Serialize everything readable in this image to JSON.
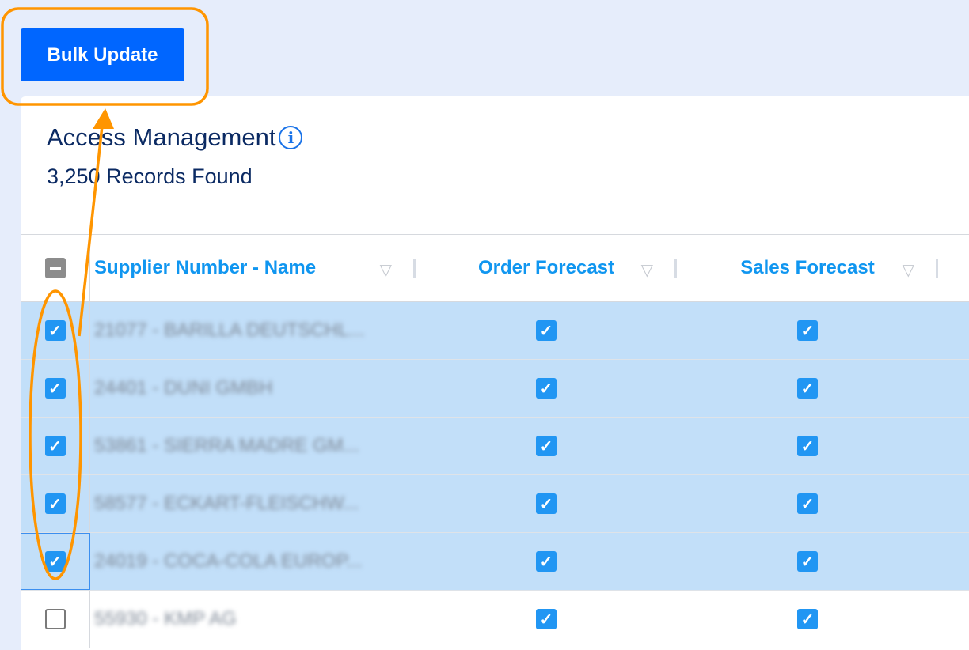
{
  "toolbar": {
    "bulk_update_label": "Bulk Update"
  },
  "header": {
    "title": "Access Management",
    "info_icon": "info-icon",
    "records_found": "3,250 Records Found"
  },
  "table": {
    "columns": [
      {
        "label": "Supplier Number - Name"
      },
      {
        "label": "Order Forecast"
      },
      {
        "label": "Sales Forecast"
      }
    ],
    "select_all_state": "indeterminate",
    "rows": [
      {
        "name": "21077 - BARILLA DEUTSCHL...",
        "selected": true,
        "order_forecast": true,
        "sales_forecast": true
      },
      {
        "name": "24401 - DUNI GMBH",
        "selected": true,
        "order_forecast": true,
        "sales_forecast": true
      },
      {
        "name": "53861 - SIERRA MADRE GM...",
        "selected": true,
        "order_forecast": true,
        "sales_forecast": true
      },
      {
        "name": "58577 - ECKART-FLEISCHW...",
        "selected": true,
        "order_forecast": true,
        "sales_forecast": true
      },
      {
        "name": "24019 - COCA-COLA EUROP...",
        "selected": true,
        "order_forecast": true,
        "sales_forecast": true
      },
      {
        "name": "55930 - KMP AG",
        "selected": false,
        "order_forecast": true,
        "sales_forecast": true
      }
    ]
  },
  "colors": {
    "accent": "#0066ff",
    "header_text": "#1096f0",
    "selected_row": "#c2dff9",
    "annotation": "#ff9500",
    "title": "#0b2a63"
  }
}
